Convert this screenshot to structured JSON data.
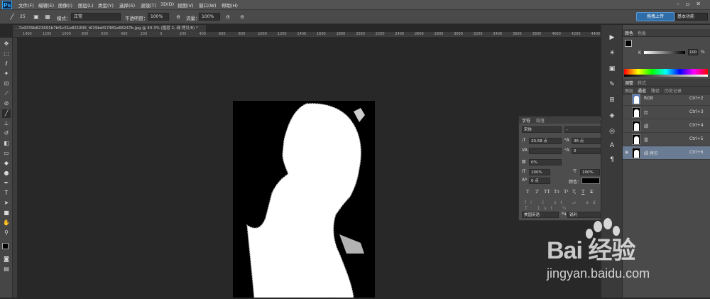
{
  "app": {
    "logo": "Ps"
  },
  "menu": [
    "文件(F)",
    "编辑(E)",
    "图像(I)",
    "图层(L)",
    "类型(Y)",
    "选择(S)",
    "滤镜(T)",
    "3D(D)",
    "视图(V)",
    "窗口(W)",
    "帮助(H)"
  ],
  "options": {
    "brush_size": "25",
    "mode_label": "模式：",
    "mode_value": "正常",
    "opacity_label": "不透明度：",
    "opacity_value": "100%",
    "flow_label": "流量：",
    "flow_value": "100%"
  },
  "header_right": {
    "upload_label": "拖拽上传",
    "workspace": "基本功能"
  },
  "document": {
    "tab_title": "...7a9339b821691b7bf1c51e821806_t019bdf17481a68247b.jpg @ 40.3% (图层 2, 绿 拷贝/8) *"
  },
  "ruler_numbers": [
    "1400",
    "1200",
    "1000",
    "800",
    "600",
    "400",
    "200",
    "0",
    "200",
    "400",
    "600",
    "800",
    "1000",
    "1200",
    "1400",
    "1600",
    "1800",
    "2000",
    "2200",
    "2400",
    "2600",
    "2800",
    "3000",
    "3200",
    "3400",
    "3600",
    "3800",
    "4000",
    "4200",
    "4400"
  ],
  "color_panel": {
    "tabs": [
      "颜色",
      "色板"
    ],
    "channel_label": "K",
    "value": "100",
    "unit": "%"
  },
  "channels_panel": {
    "tabs": [
      "调整",
      "样式"
    ],
    "subtabs": [
      "图层",
      "通道",
      "路径",
      "历史记录"
    ],
    "rows": [
      {
        "name": "RGB",
        "shortcut": "Ctrl+2"
      },
      {
        "name": "红",
        "shortcut": "Ctrl+3"
      },
      {
        "name": "绿",
        "shortcut": "Ctrl+4"
      },
      {
        "name": "蓝",
        "shortcut": "Ctrl+5"
      },
      {
        "name": "绿 拷贝",
        "shortcut": "Ctrl+6"
      }
    ]
  },
  "character_panel": {
    "tabs": [
      "字符",
      "段落"
    ],
    "font_family": "宋体",
    "font_style": "-",
    "font_size": "20.58 点",
    "leading": "36 点",
    "kerning": "",
    "tracking": "0",
    "tsume": "0%",
    "vscale": "100%",
    "hscale": "100%",
    "baseline": "0 点",
    "color_label": "颜色：",
    "type_buttons": [
      "T",
      "T",
      "TT",
      "Tт",
      "T¹",
      "T,",
      "T",
      "T"
    ],
    "language": "美国英语",
    "aa_prefix": "ªa",
    "antialias": "锐利"
  },
  "watermark": {
    "brand": "Bai 经验",
    "url": "jingyan.baidu.com"
  }
}
